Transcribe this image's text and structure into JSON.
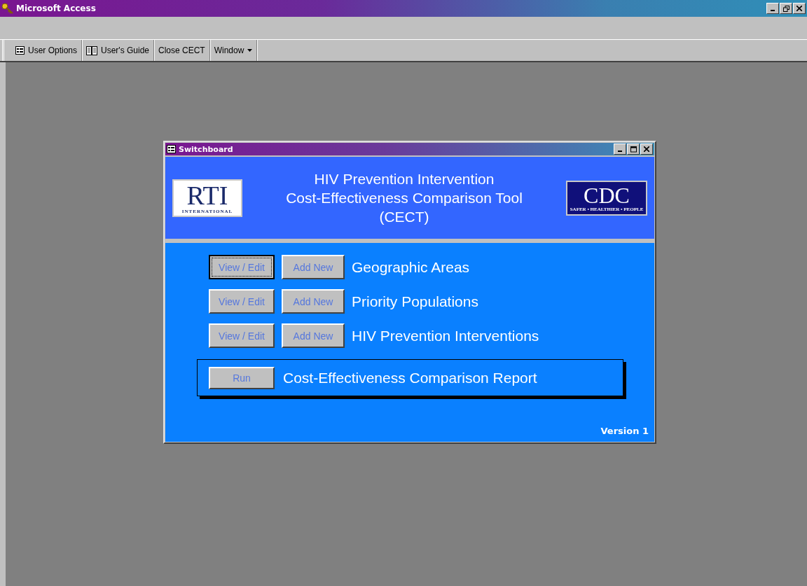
{
  "app_window": {
    "title": "Microsoft Access"
  },
  "toolbar": [
    {
      "kind": "options",
      "label": "User Options"
    },
    {
      "kind": "guide",
      "label": "User's Guide"
    },
    {
      "kind": "button",
      "label": "Close CECT"
    },
    {
      "kind": "menu",
      "label": "Window"
    }
  ],
  "switchboard": {
    "title": "Switchboard",
    "header": {
      "title_lines": [
        "HIV Prevention Intervention",
        "Cost-Effectiveness Comparison Tool",
        "(CECT)"
      ],
      "left_logo": {
        "name": "RTI",
        "subtitle": "INTERNATIONAL"
      },
      "right_logo": {
        "name": "CDC",
        "subtitle": "SAFER • HEALTHIER • PEOPLE"
      }
    },
    "rows": [
      {
        "view_button": {
          "label": "View / Edit",
          "focused": true
        },
        "add_button": {
          "label": "Add New",
          "focused": false
        },
        "label": "Geographic Areas"
      },
      {
        "view_button": {
          "label": "View / Edit",
          "focused": false
        },
        "add_button": {
          "label": "Add New",
          "focused": false
        },
        "label": "Priority Populations"
      },
      {
        "view_button": {
          "label": "View / Edit",
          "focused": false
        },
        "add_button": {
          "label": "Add New",
          "focused": false
        },
        "label": "HIV Prevention Interventions"
      }
    ],
    "report": {
      "button": "Run",
      "label": "Cost-Effectiveness Comparison Report"
    },
    "version": "Version 1"
  }
}
